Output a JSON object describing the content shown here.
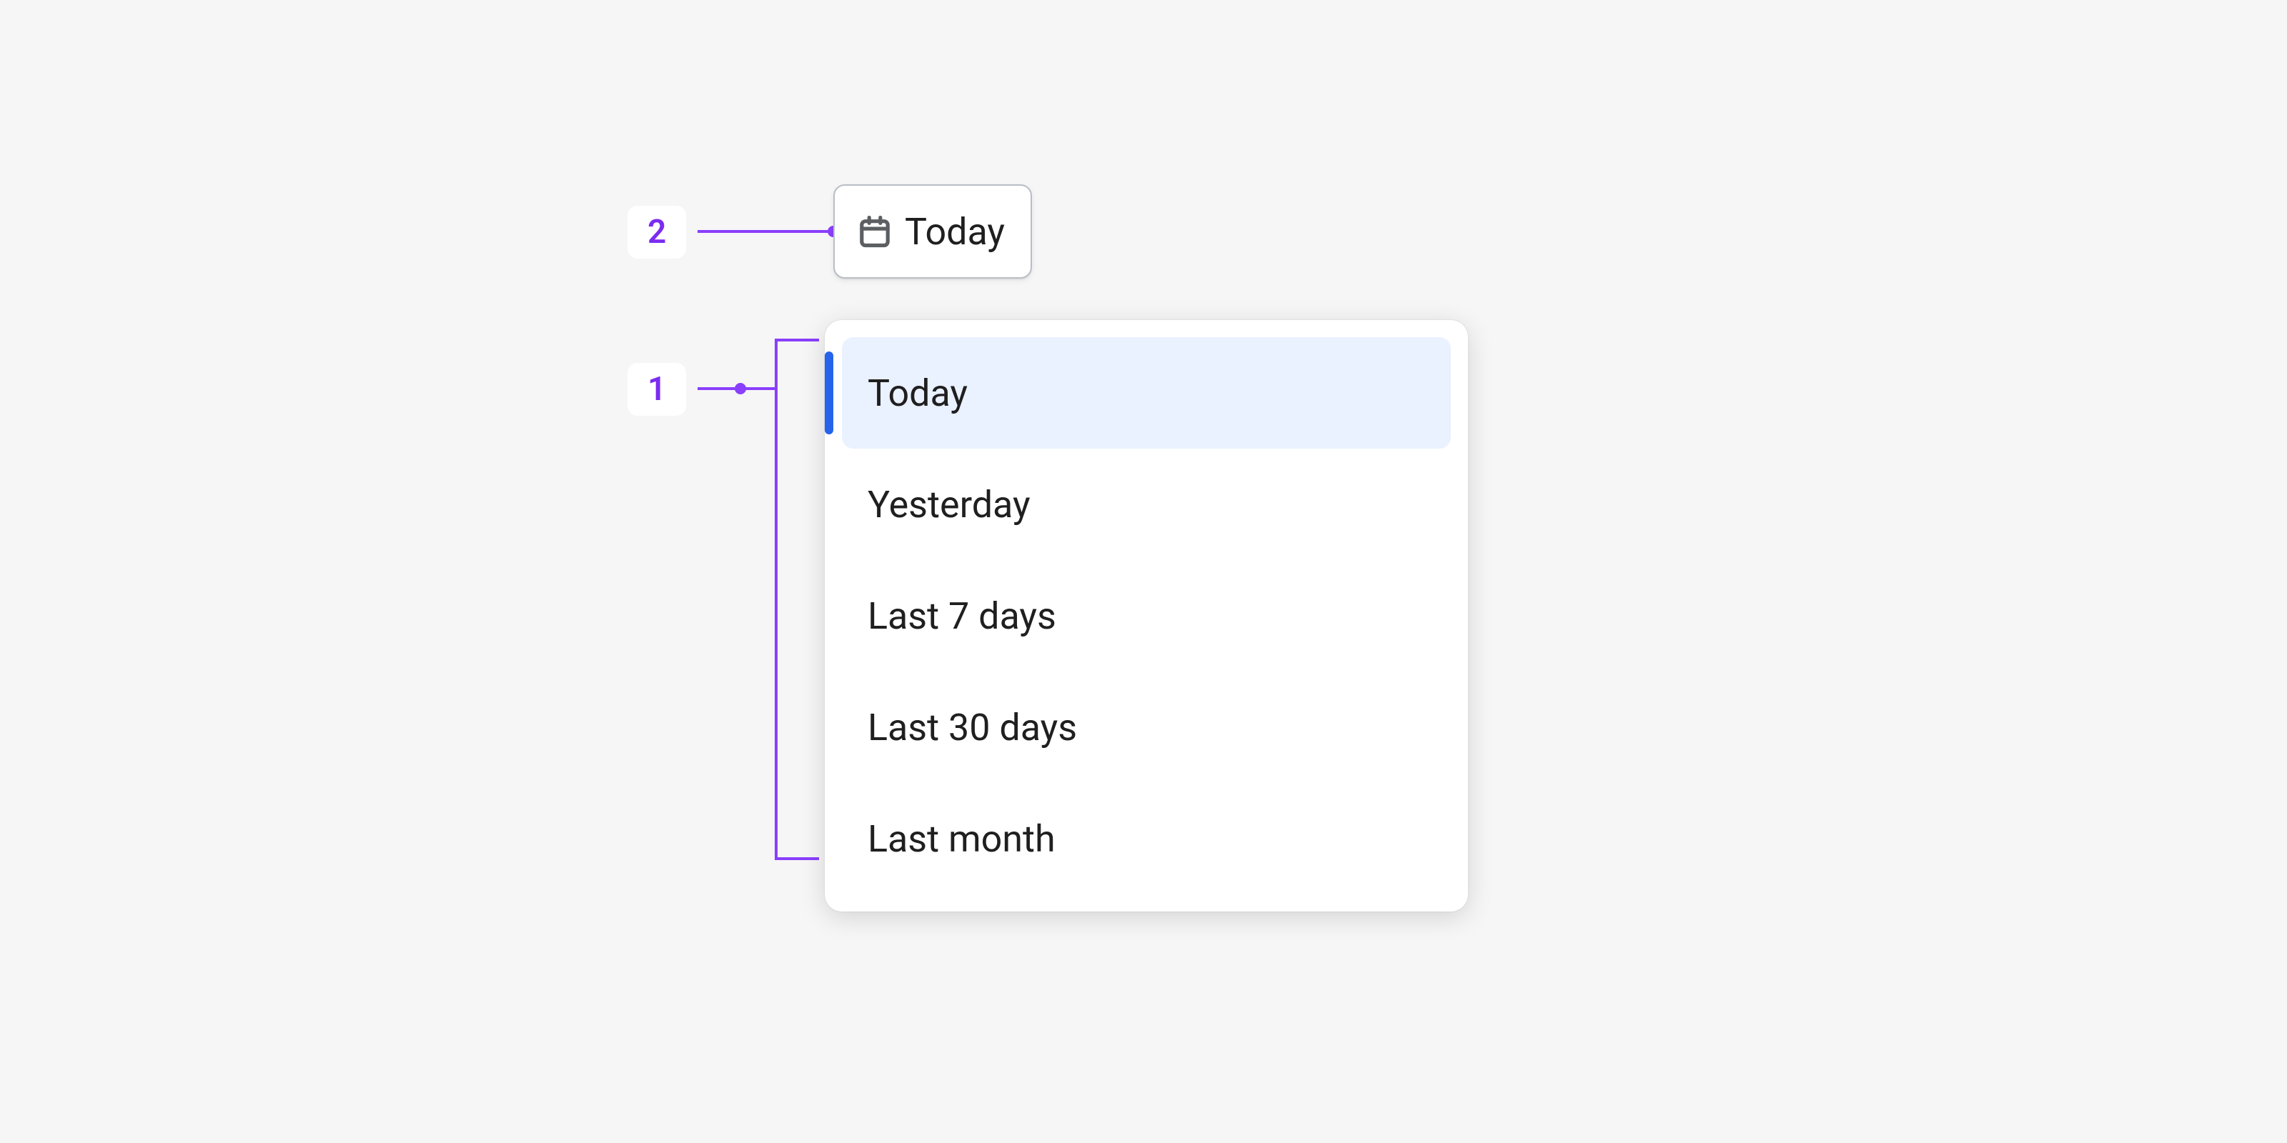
{
  "annotations": {
    "marker2": "2",
    "marker1": "1"
  },
  "activator": {
    "label": "Today"
  },
  "options": [
    {
      "label": "Today",
      "selected": true
    },
    {
      "label": "Yesterday",
      "selected": false
    },
    {
      "label": "Last 7 days",
      "selected": false
    },
    {
      "label": "Last 30 days",
      "selected": false
    },
    {
      "label": "Last month",
      "selected": false
    }
  ],
  "colors": {
    "annotation": "#8a3ffc",
    "selectedBg": "#eaf1ff",
    "selectedBar": "#2563eb"
  }
}
